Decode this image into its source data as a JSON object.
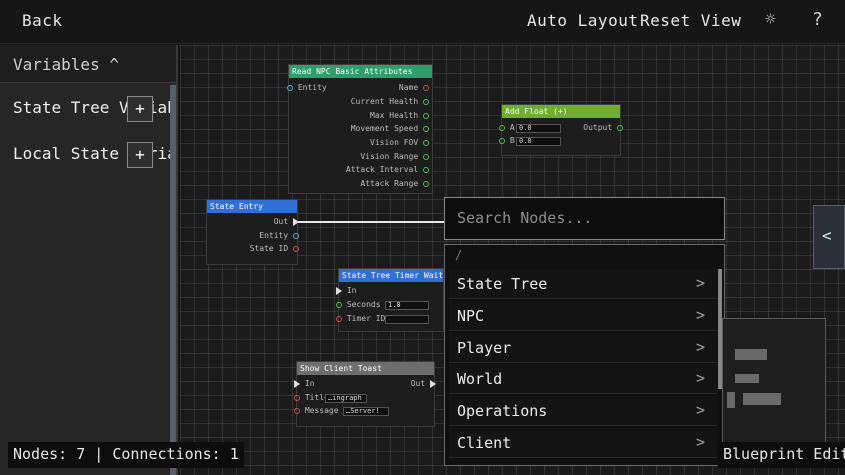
{
  "topbar": {
    "back_label": "Back",
    "auto_layout_label": "Auto Layout",
    "reset_view_label": "Reset View",
    "settings_icon": "☼",
    "help_icon": "?"
  },
  "sidebar": {
    "header_label": "Variables ^",
    "items": [
      {
        "label": "State Tree Variables",
        "add_label": "+"
      },
      {
        "label": "Local State Variables",
        "add_label": "+"
      }
    ]
  },
  "nodes": {
    "read_npc": {
      "title": "Read NPC Basic Attributes",
      "input": "Entity",
      "outputs": [
        "Name",
        "Current Health",
        "Max Health",
        "Movement Speed",
        "Vision FOV",
        "Vision Range",
        "Attack Interval",
        "Attack Range"
      ]
    },
    "add_float": {
      "title": "Add Float (+)",
      "inputs": [
        {
          "label": "A",
          "value": "0.0"
        },
        {
          "label": "B",
          "value": "0.0"
        }
      ],
      "output": "Output"
    },
    "state_entry": {
      "title": "State Entry",
      "outputs": [
        "Out",
        "Entity",
        "State ID"
      ]
    },
    "timer_wait": {
      "title": "State Tree Timer Wait C",
      "in_label": "In",
      "seconds_label": "Seconds",
      "seconds_value": "1.0",
      "timer_label": "Timer ID"
    },
    "show_toast": {
      "title": "Show Client Toast",
      "in_label": "In",
      "out_label": "Out",
      "title_label": "Title",
      "title_value": "…ingraph",
      "message_label": "Message",
      "message_value": "…Server!"
    }
  },
  "search": {
    "placeholder": "Search Nodes...",
    "path": "/",
    "categories": [
      {
        "label": "State Tree",
        "chevron": ">"
      },
      {
        "label": "NPC",
        "chevron": ">"
      },
      {
        "label": "Player",
        "chevron": ">"
      },
      {
        "label": "World",
        "chevron": ">"
      },
      {
        "label": "Operations",
        "chevron": ">"
      },
      {
        "label": "Client",
        "chevron": ">"
      }
    ]
  },
  "right_panel": {
    "toggle_icon": "<"
  },
  "status": {
    "summary": "Nodes: 7 | Connections: 1",
    "editor_label": "Blueprint Editor"
  },
  "colors": {
    "read_node_header": "#2e9e6a",
    "add_node_header": "#6fae2e",
    "entry_node_header": "#2f6fd6",
    "timer_node_header": "#2f6fd6",
    "toast_node_header": "#6e6e6e"
  }
}
